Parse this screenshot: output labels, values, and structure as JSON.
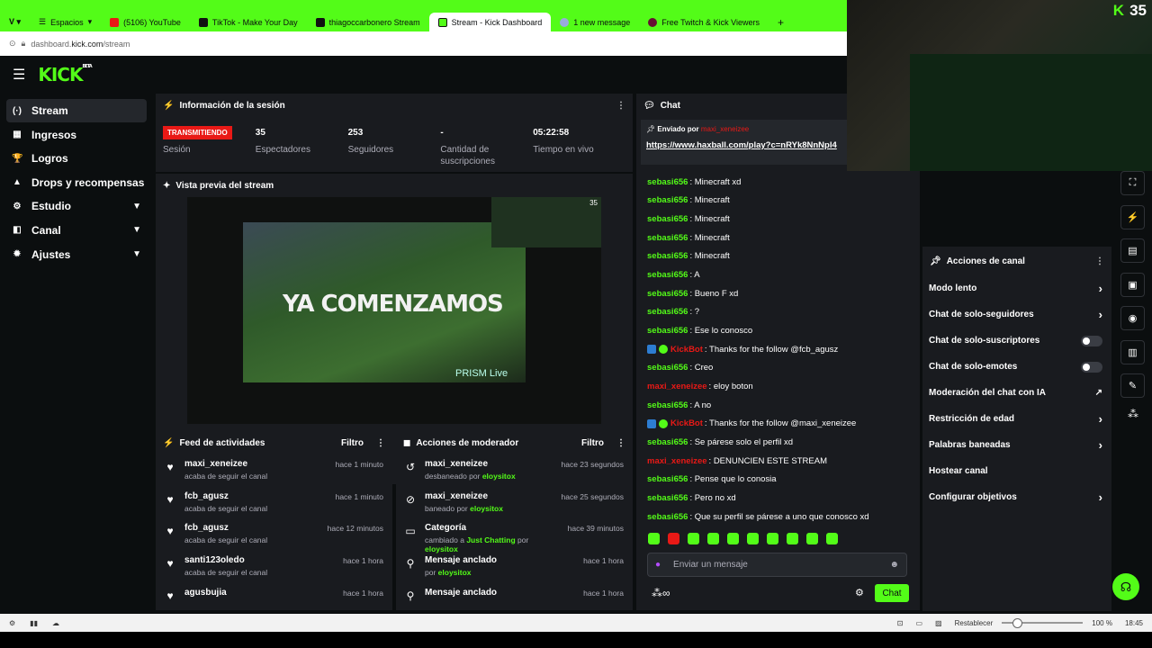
{
  "tabs": [
    {
      "label": "Espacios"
    },
    {
      "label": "(5106) YouTube"
    },
    {
      "label": "TikTok - Make Your Day"
    },
    {
      "label": "thiagoccarbonero Stream"
    },
    {
      "label": "Stream - Kick Dashboard"
    },
    {
      "label": "1 new message"
    },
    {
      "label": "Free Twitch & Kick Viewers"
    },
    {
      "label": "+"
    }
  ],
  "address": {
    "prefix": "dashboard.",
    "domain": "kick.com",
    "path": "/stream"
  },
  "logo": {
    "text": "KICK",
    "tag": "BETA"
  },
  "sidebar": {
    "items": [
      {
        "label": "Stream",
        "icon": "(·)"
      },
      {
        "label": "Ingresos",
        "icon": "▦"
      },
      {
        "label": "Logros",
        "icon": "🏆"
      },
      {
        "label": "Drops y recompensas",
        "icon": "▲"
      },
      {
        "label": "Estudio",
        "icon": "⚙"
      },
      {
        "label": "Canal",
        "icon": "◧"
      },
      {
        "label": "Ajustes",
        "icon": "✹"
      }
    ]
  },
  "session": {
    "title": "Información de la sesión",
    "live_badge": "TRANSMITIENDO",
    "status_label": "Sesión",
    "stats": [
      {
        "value": "35",
        "label": "Espectadores"
      },
      {
        "value": "253",
        "label": "Seguidores"
      },
      {
        "value": "-",
        "label": "Cantidad de suscripciones"
      },
      {
        "value": "05:22:58",
        "label": "Tiempo en vivo"
      }
    ]
  },
  "preview": {
    "title": "Vista previa del stream",
    "overlay_text": "YA COMENZAMOS",
    "prism": "PRISM Live",
    "viewers": "35"
  },
  "feed": {
    "title": "Feed de actividades",
    "filter": "Filtro",
    "items": [
      {
        "user": "maxi_xeneizee",
        "text": "acaba de seguir el canal",
        "time": "hace 1 minuto"
      },
      {
        "user": "fcb_agusz",
        "text": "acaba de seguir el canal",
        "time": "hace 1 minuto"
      },
      {
        "user": "fcb_agusz",
        "text": "acaba de seguir el canal",
        "time": "hace 12 minutos"
      },
      {
        "user": "santi123oledo",
        "text": "acaba de seguir el canal",
        "time": "hace 1 hora"
      },
      {
        "user": "agusbujia",
        "text": "",
        "time": "hace 1 hora"
      }
    ]
  },
  "mod": {
    "title": "Acciones de moderador",
    "filter": "Filtro",
    "items": [
      {
        "title": "maxi_xeneizee",
        "pre": "desbaneado por",
        "who": "eloysitox",
        "time": "hace 23 segundos",
        "icon": "↺"
      },
      {
        "title": "maxi_xeneizee",
        "pre": "baneado por",
        "who": "eloysitox",
        "time": "hace 25 segundos",
        "icon": "⊘"
      },
      {
        "title": "Categoría",
        "pre": "cambiado a",
        "who": "Just Chatting",
        "post": "por",
        "who2": "eloysitox",
        "time": "hace 39 minutos",
        "icon": "▭"
      },
      {
        "title": "Mensaje anclado",
        "pre": "por",
        "who": "eloysitox",
        "time": "hace 1 hora",
        "icon": "⚲"
      },
      {
        "title": "Mensaje anclado",
        "pre": "",
        "who": "",
        "time": "hace 1 hora",
        "icon": "⚲"
      }
    ]
  },
  "chat": {
    "title": "Chat",
    "pinned_label": "Enviado por",
    "pinned_user": "maxi_xeneizee",
    "pinned_url": "https://www.haxball.com/play?c=nRYk8NnNpl4",
    "messages": [
      {
        "user": "sebasi656",
        "text": ": Minecraft xd",
        "red": false
      },
      {
        "user": "sebasi656",
        "text": ": Minecraft",
        "red": false
      },
      {
        "user": "sebasi656",
        "text": ": Minecraft",
        "red": false
      },
      {
        "user": "sebasi656",
        "text": ": Minecraft",
        "red": false
      },
      {
        "user": "sebasi656",
        "text": ": Minecraft",
        "red": false
      },
      {
        "user": "sebasi656",
        "text": ": A",
        "red": false
      },
      {
        "user": "sebasi656",
        "text": ": Bueno F xd",
        "red": false
      },
      {
        "user": "sebasi656",
        "text": ": ?",
        "red": false
      },
      {
        "user": "sebasi656",
        "text": ": Ese lo conosco",
        "red": false
      },
      {
        "user": "KickBot",
        "text": ": Thanks for the follow @fcb_agusz",
        "red": true,
        "bot": true
      },
      {
        "user": "sebasi656",
        "text": ": Creo",
        "red": false
      },
      {
        "user": "maxi_xeneizee",
        "text": ": eloy boton",
        "red": true
      },
      {
        "user": "sebasi656",
        "text": ": A no",
        "red": false
      },
      {
        "user": "KickBot",
        "text": ": Thanks for the follow @maxi_xeneizee",
        "red": true,
        "bot": true
      },
      {
        "user": "sebasi656",
        "text": ": Se párese solo el perfil xd",
        "red": false
      },
      {
        "user": "maxi_xeneizee",
        "text": ": DENUNCIEN ESTE STREAM",
        "red": true
      },
      {
        "user": "sebasi656",
        "text": ": Pense que lo conosia",
        "red": false
      },
      {
        "user": "sebasi656",
        "text": ": Pero no xd",
        "red": false
      },
      {
        "user": "sebasi656",
        "text": ": Que su perfil se párese a uno que conosco xd",
        "red": false
      }
    ],
    "input_placeholder": "Enviar un mensaje",
    "send": "Chat"
  },
  "channel_actions": {
    "title": "Acciones de canal",
    "items": [
      {
        "label": "Modo lento",
        "kind": "arrow"
      },
      {
        "label": "Chat de solo-seguidores",
        "kind": "arrow"
      },
      {
        "label": "Chat de solo-suscriptores",
        "kind": "toggle"
      },
      {
        "label": "Chat de solo-emotes",
        "kind": "toggle"
      },
      {
        "label": "Moderación del chat con IA",
        "kind": "chart"
      },
      {
        "label": "Restricción de edad",
        "kind": "arrow"
      },
      {
        "label": "Palabras baneadas",
        "kind": "arrow"
      },
      {
        "label": "Hostear canal",
        "kind": "none"
      },
      {
        "label": "Configurar objetivos",
        "kind": "arrow"
      }
    ]
  },
  "cam": {
    "badge": "35"
  },
  "status": {
    "restablecer": "Restablecer",
    "zoom": "100 %",
    "time": "18:45"
  },
  "colors": {
    "accent": "#53fc18",
    "live": "#e91916",
    "panel": "#191b1f"
  }
}
